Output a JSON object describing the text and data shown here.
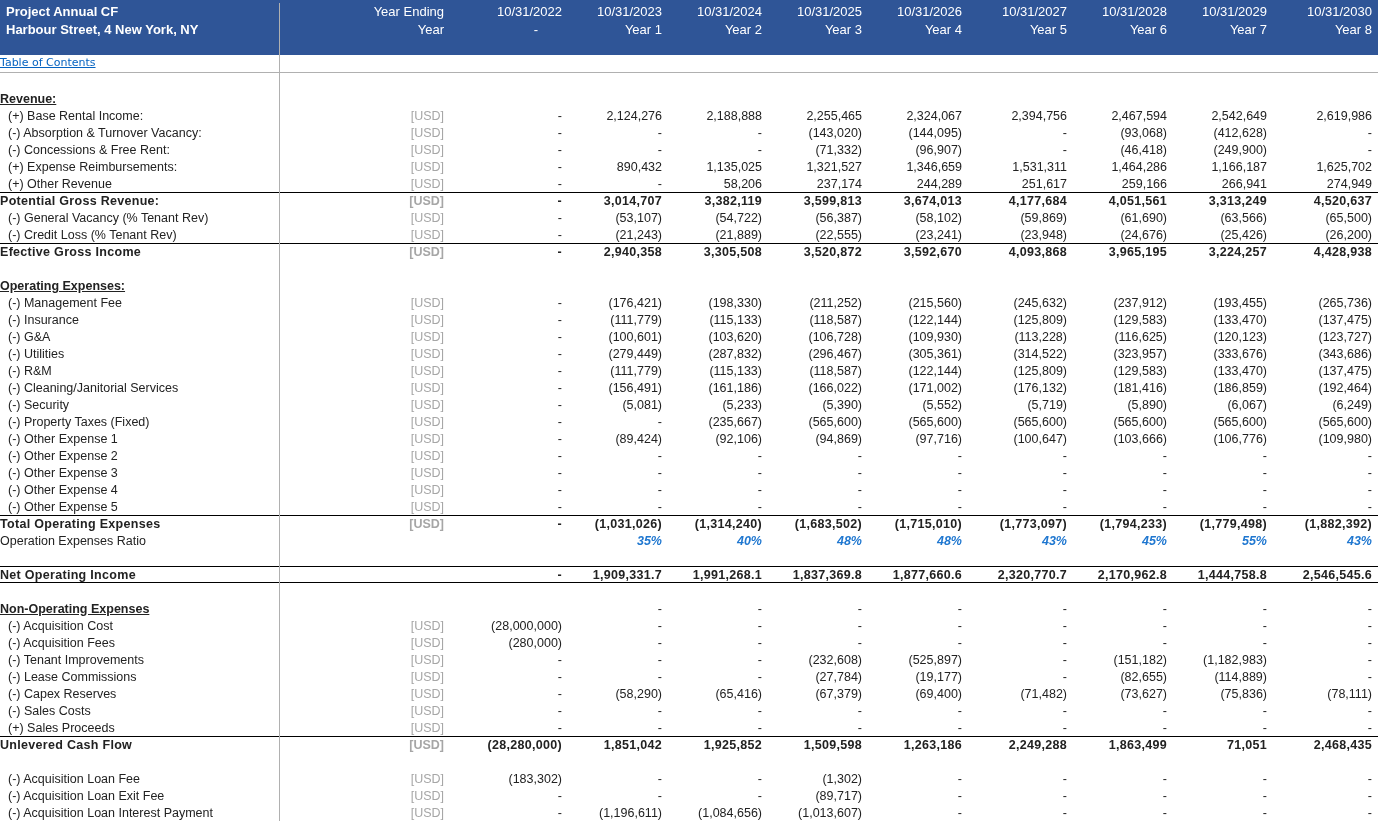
{
  "header": {
    "title": "Project Annual CF",
    "subtitle": "Harbour Street, 4 New York, NY",
    "unit_heading": "Year Ending",
    "unit_subheading": "Year",
    "columns": [
      {
        "date": "10/31/2022",
        "period": "-"
      },
      {
        "date": "10/31/2023",
        "period": "Year 1"
      },
      {
        "date": "10/31/2024",
        "period": "Year 2"
      },
      {
        "date": "10/31/2025",
        "period": "Year 3"
      },
      {
        "date": "10/31/2026",
        "period": "Year 4"
      },
      {
        "date": "10/31/2027",
        "period": "Year 5"
      },
      {
        "date": "10/31/2028",
        "period": "Year 6"
      },
      {
        "date": "10/31/2029",
        "period": "Year 7"
      },
      {
        "date": "10/31/2030",
        "period": "Year 8"
      }
    ]
  },
  "toc_link": "Table of Contents",
  "rows": [
    {
      "kind": "blank"
    },
    {
      "kind": "heading",
      "label": "Revenue:"
    },
    {
      "kind": "item",
      "label": "(+) Base Rental Income:",
      "unit": "[USD]",
      "values": [
        "-",
        "2,124,276",
        "2,188,888",
        "2,255,465",
        "2,324,067",
        "2,394,756",
        "2,467,594",
        "2,542,649",
        "2,619,986"
      ]
    },
    {
      "kind": "item",
      "label": "(-) Absorption & Turnover Vacancy:",
      "unit": "[USD]",
      "values": [
        "-",
        "-",
        "-",
        "(143,020)",
        "(144,095)",
        "-",
        "(93,068)",
        "(412,628)",
        "-"
      ]
    },
    {
      "kind": "item",
      "label": "(-) Concessions & Free Rent:",
      "unit": "[USD]",
      "values": [
        "-",
        "-",
        "-",
        "(71,332)",
        "(96,907)",
        "-",
        "(46,418)",
        "(249,900)",
        "-"
      ]
    },
    {
      "kind": "item",
      "label": "(+) Expense Reimbursements:",
      "unit": "[USD]",
      "values": [
        "-",
        "890,432",
        "1,135,025",
        "1,321,527",
        "1,346,659",
        "1,531,311",
        "1,464,286",
        "1,166,187",
        "1,625,702"
      ]
    },
    {
      "kind": "item",
      "label": "(+) Other Revenue",
      "unit": "[USD]",
      "values": [
        "-",
        "-",
        "58,206",
        "237,174",
        "244,289",
        "251,617",
        "259,166",
        "266,941",
        "274,949"
      ]
    },
    {
      "kind": "total",
      "label": "Potential Gross Revenue:",
      "unit": "[USD]",
      "values": [
        "-",
        "3,014,707",
        "3,382,119",
        "3,599,813",
        "3,674,013",
        "4,177,684",
        "4,051,561",
        "3,313,249",
        "4,520,637"
      ]
    },
    {
      "kind": "item",
      "label": "(-) General Vacancy (% Tenant Rev)",
      "unit": "[USD]",
      "values": [
        "-",
        "(53,107)",
        "(54,722)",
        "(56,387)",
        "(58,102)",
        "(59,869)",
        "(61,690)",
        "(63,566)",
        "(65,500)"
      ]
    },
    {
      "kind": "item",
      "label": "(-) Credit Loss (% Tenant Rev)",
      "unit": "[USD]",
      "values": [
        "-",
        "(21,243)",
        "(21,889)",
        "(22,555)",
        "(23,241)",
        "(23,948)",
        "(24,676)",
        "(25,426)",
        "(26,200)"
      ]
    },
    {
      "kind": "total",
      "label": "Efective Gross Income",
      "unit": "[USD]",
      "values": [
        "-",
        "2,940,358",
        "3,305,508",
        "3,520,872",
        "3,592,670",
        "4,093,868",
        "3,965,195",
        "3,224,257",
        "4,428,938"
      ]
    },
    {
      "kind": "blank"
    },
    {
      "kind": "heading",
      "label": "Operating Expenses:"
    },
    {
      "kind": "item",
      "label": "(-) Management Fee",
      "unit": "[USD]",
      "values": [
        "-",
        "(176,421)",
        "(198,330)",
        "(211,252)",
        "(215,560)",
        "(245,632)",
        "(237,912)",
        "(193,455)",
        "(265,736)"
      ]
    },
    {
      "kind": "item",
      "label": "(-) Insurance",
      "unit": "[USD]",
      "values": [
        "-",
        "(111,779)",
        "(115,133)",
        "(118,587)",
        "(122,144)",
        "(125,809)",
        "(129,583)",
        "(133,470)",
        "(137,475)"
      ]
    },
    {
      "kind": "item",
      "label": "(-) G&A",
      "unit": "[USD]",
      "values": [
        "-",
        "(100,601)",
        "(103,620)",
        "(106,728)",
        "(109,930)",
        "(113,228)",
        "(116,625)",
        "(120,123)",
        "(123,727)"
      ]
    },
    {
      "kind": "item",
      "label": "(-) Utilities",
      "unit": "[USD]",
      "values": [
        "-",
        "(279,449)",
        "(287,832)",
        "(296,467)",
        "(305,361)",
        "(314,522)",
        "(323,957)",
        "(333,676)",
        "(343,686)"
      ]
    },
    {
      "kind": "item",
      "label": "(-) R&M",
      "unit": "[USD]",
      "values": [
        "-",
        "(111,779)",
        "(115,133)",
        "(118,587)",
        "(122,144)",
        "(125,809)",
        "(129,583)",
        "(133,470)",
        "(137,475)"
      ]
    },
    {
      "kind": "item",
      "label": "(-) Cleaning/Janitorial Services",
      "unit": "[USD]",
      "values": [
        "-",
        "(156,491)",
        "(161,186)",
        "(166,022)",
        "(171,002)",
        "(176,132)",
        "(181,416)",
        "(186,859)",
        "(192,464)"
      ]
    },
    {
      "kind": "item",
      "label": "(-) Security",
      "unit": "[USD]",
      "values": [
        "-",
        "(5,081)",
        "(5,233)",
        "(5,390)",
        "(5,552)",
        "(5,719)",
        "(5,890)",
        "(6,067)",
        "(6,249)"
      ]
    },
    {
      "kind": "item",
      "label": "(-) Property Taxes (Fixed)",
      "unit": "[USD]",
      "values": [
        "-",
        "-",
        "(235,667)",
        "(565,600)",
        "(565,600)",
        "(565,600)",
        "(565,600)",
        "(565,600)",
        "(565,600)"
      ]
    },
    {
      "kind": "item",
      "label": "(-) Other Expense 1",
      "unit": "[USD]",
      "values": [
        "-",
        "(89,424)",
        "(92,106)",
        "(94,869)",
        "(97,716)",
        "(100,647)",
        "(103,666)",
        "(106,776)",
        "(109,980)"
      ]
    },
    {
      "kind": "item",
      "label": "(-) Other Expense 2",
      "unit": "[USD]",
      "values": [
        "-",
        "-",
        "-",
        "-",
        "-",
        "-",
        "-",
        "-",
        "-"
      ]
    },
    {
      "kind": "item",
      "label": "(-) Other Expense 3",
      "unit": "[USD]",
      "values": [
        "-",
        "-",
        "-",
        "-",
        "-",
        "-",
        "-",
        "-",
        "-"
      ]
    },
    {
      "kind": "item",
      "label": "(-) Other Expense 4",
      "unit": "[USD]",
      "values": [
        "-",
        "-",
        "-",
        "-",
        "-",
        "-",
        "-",
        "-",
        "-"
      ]
    },
    {
      "kind": "item",
      "label": "(-) Other Expense 5",
      "unit": "[USD]",
      "values": [
        "-",
        "-",
        "-",
        "-",
        "-",
        "-",
        "-",
        "-",
        "-"
      ]
    },
    {
      "kind": "total",
      "label": "Total Operating Expenses",
      "unit": "[USD]",
      "values": [
        "-",
        "(1,031,026)",
        "(1,314,240)",
        "(1,683,502)",
        "(1,715,010)",
        "(1,773,097)",
        "(1,794,233)",
        "(1,779,498)",
        "(1,882,392)"
      ]
    },
    {
      "kind": "ratio",
      "label": "Operation Expenses Ratio",
      "values": [
        "35%",
        "40%",
        "48%",
        "48%",
        "43%",
        "45%",
        "55%",
        "43%"
      ]
    },
    {
      "kind": "blank"
    },
    {
      "kind": "key_total",
      "label": "Net Operating Income",
      "values": [
        "-",
        "1,909,331.7",
        "1,991,268.1",
        "1,837,369.8",
        "1,877,660.6",
        "2,320,770.7",
        "2,170,962.8",
        "1,444,758.8",
        "2,546,545.6"
      ]
    },
    {
      "kind": "blank"
    },
    {
      "kind": "heading",
      "label": "Non-Operating Expenses",
      "values": [
        "-",
        "-",
        "-",
        "-",
        "-",
        "-",
        "-",
        "-"
      ]
    },
    {
      "kind": "item",
      "label": "(-) Acquisition Cost",
      "unit": "[USD]",
      "values": [
        "(28,000,000)",
        "-",
        "-",
        "-",
        "-",
        "-",
        "-",
        "-",
        "-"
      ]
    },
    {
      "kind": "item",
      "label": "(-) Acquisition Fees",
      "unit": "[USD]",
      "values": [
        "(280,000)",
        "-",
        "-",
        "-",
        "-",
        "-",
        "-",
        "-",
        "-"
      ]
    },
    {
      "kind": "item",
      "label": "(-) Tenant Improvements",
      "unit": "[USD]",
      "values": [
        "-",
        "-",
        "-",
        "(232,608)",
        "(525,897)",
        "-",
        "(151,182)",
        "(1,182,983)",
        "-"
      ]
    },
    {
      "kind": "item",
      "label": "(-) Lease Commissions",
      "unit": "[USD]",
      "values": [
        "-",
        "-",
        "-",
        "(27,784)",
        "(19,177)",
        "-",
        "(82,655)",
        "(114,889)",
        "-"
      ]
    },
    {
      "kind": "item",
      "label": "(-) Capex Reserves",
      "unit": "[USD]",
      "values": [
        "-",
        "(58,290)",
        "(65,416)",
        "(67,379)",
        "(69,400)",
        "(71,482)",
        "(73,627)",
        "(75,836)",
        "(78,111)"
      ]
    },
    {
      "kind": "item",
      "label": "(-) Sales Costs",
      "unit": "[USD]",
      "values": [
        "-",
        "-",
        "-",
        "-",
        "-",
        "-",
        "-",
        "-",
        "-"
      ]
    },
    {
      "kind": "item",
      "label": "(+) Sales Proceeds",
      "unit": "[USD]",
      "values": [
        "-",
        "-",
        "-",
        "-",
        "-",
        "-",
        "-",
        "-",
        "-"
      ]
    },
    {
      "kind": "total",
      "label": "Unlevered Cash Flow",
      "unit": "[USD]",
      "values": [
        "(28,280,000)",
        "1,851,042",
        "1,925,852",
        "1,509,598",
        "1,263,186",
        "2,249,288",
        "1,863,499",
        "71,051",
        "2,468,435"
      ]
    },
    {
      "kind": "blank"
    },
    {
      "kind": "item",
      "label": "(-) Acquisition Loan Fee",
      "unit": "[USD]",
      "values": [
        "(183,302)",
        "-",
        "-",
        "(1,302)",
        "-",
        "-",
        "-",
        "-",
        "-"
      ]
    },
    {
      "kind": "item",
      "label": "(-) Acquisition Loan Exit Fee",
      "unit": "[USD]",
      "values": [
        "-",
        "-",
        "-",
        "(89,717)",
        "-",
        "-",
        "-",
        "-",
        "-"
      ]
    },
    {
      "kind": "item",
      "label": "(-) Acquisition Loan Interest Payment",
      "unit": "[USD]",
      "values": [
        "-",
        "(1,196,611)",
        "(1,084,656)",
        "(1,013,607)",
        "-",
        "-",
        "-",
        "-",
        "-"
      ]
    }
  ]
}
